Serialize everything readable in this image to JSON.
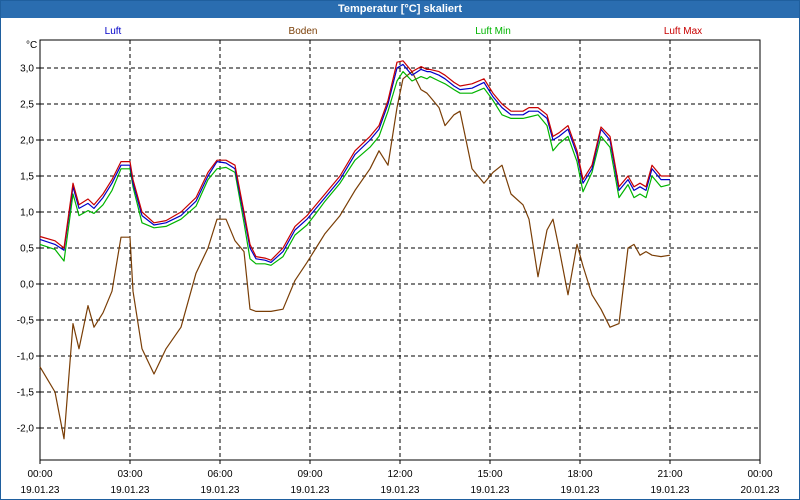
{
  "window": {
    "title": "Temperatur [°C] skaliert"
  },
  "chart_data": {
    "type": "line",
    "title": "Temperatur [°C] skaliert",
    "yunit": "°C",
    "ylim": [
      -2.5,
      3.2
    ],
    "yticks": [
      3.0,
      2.5,
      2.0,
      1.5,
      1.0,
      0.5,
      0.0,
      -0.5,
      -1.0,
      -1.5,
      -2.0
    ],
    "ytick_labels": [
      "3,0",
      "2,5",
      "2,0",
      "1,5",
      "1,0",
      "0,5",
      "0,0",
      "-0,5",
      "-1,0",
      "-1,5",
      "-2,0"
    ],
    "xlim": [
      0,
      24
    ],
    "xticks": [
      {
        "h": 0,
        "time": "00:00",
        "date": "19.01.23"
      },
      {
        "h": 3,
        "time": "03:00",
        "date": "19.01.23"
      },
      {
        "h": 6,
        "time": "06:00",
        "date": "19.01.23"
      },
      {
        "h": 9,
        "time": "09:00",
        "date": "19.01.23"
      },
      {
        "h": 12,
        "time": "12:00",
        "date": "19.01.23"
      },
      {
        "h": 15,
        "time": "15:00",
        "date": "19.01.23"
      },
      {
        "h": 18,
        "time": "18:00",
        "date": "19.01.23"
      },
      {
        "h": 21,
        "time": "21:00",
        "date": "19.01.23"
      },
      {
        "h": 24,
        "time": "00:00",
        "date": "20.01.23"
      }
    ],
    "grid": true,
    "legend_position": "top",
    "x": [
      0,
      0.5,
      0.8,
      1.1,
      1.3,
      1.6,
      1.8,
      2.1,
      2.4,
      2.7,
      3.0,
      3.1,
      3.4,
      3.8,
      4.2,
      4.7,
      5.2,
      5.6,
      5.9,
      6.2,
      6.5,
      6.8,
      7.0,
      7.2,
      7.5,
      7.7,
      8.1,
      8.5,
      8.9,
      9.2,
      9.5,
      10.0,
      10.5,
      11.0,
      11.3,
      11.6,
      11.9,
      12.1,
      12.4,
      12.7,
      12.9,
      13.0,
      13.3,
      13.5,
      13.8,
      14.0,
      14.4,
      14.8,
      15.1,
      15.4,
      15.7,
      16.1,
      16.3,
      16.6,
      16.9,
      17.1,
      17.3,
      17.6,
      17.9,
      18.1,
      18.4,
      18.7,
      19.0,
      19.3,
      19.6,
      19.8,
      20.0,
      20.2,
      20.4,
      20.7,
      21.0,
      21.1,
      21.4,
      21.7,
      22.0,
      22.3,
      22.6,
      23.0,
      23.3,
      23.6,
      24.0
    ],
    "series": [
      {
        "name": "Luft",
        "color": "#0000c8",
        "values": [
          0.62,
          0.55,
          0.47,
          1.35,
          1.05,
          1.12,
          1.05,
          1.2,
          1.4,
          1.65,
          1.65,
          1.4,
          0.95,
          0.82,
          0.85,
          0.95,
          1.15,
          1.5,
          1.7,
          1.68,
          1.6,
          0.95,
          0.5,
          0.35,
          0.33,
          0.3,
          0.45,
          0.75,
          0.9,
          1.05,
          1.2,
          1.45,
          1.8,
          2.0,
          2.15,
          2.5,
          3.0,
          3.05,
          2.9,
          2.98,
          2.95,
          2.95,
          2.9,
          2.85,
          2.75,
          2.7,
          2.72,
          2.8,
          2.6,
          2.45,
          2.35,
          2.35,
          2.4,
          2.4,
          2.3,
          2.0,
          2.05,
          2.15,
          1.8,
          1.4,
          1.6,
          2.15,
          2.0,
          1.3,
          1.45,
          1.3,
          1.35,
          1.3,
          1.6,
          1.45,
          1.45
        ]
      },
      {
        "name": "Boden",
        "color": "#7a3e06",
        "values": [
          -1.15,
          -1.5,
          -2.15,
          -0.55,
          -0.9,
          -0.3,
          -0.6,
          -0.4,
          -0.1,
          0.65,
          0.65,
          -0.1,
          -0.9,
          -1.25,
          -0.9,
          -0.6,
          0.15,
          0.5,
          0.9,
          0.9,
          0.6,
          0.45,
          -0.35,
          -0.38,
          -0.38,
          -0.38,
          -0.35,
          0.05,
          0.3,
          0.5,
          0.7,
          0.95,
          1.3,
          1.6,
          1.85,
          1.65,
          2.45,
          2.85,
          2.95,
          2.7,
          2.65,
          2.6,
          2.45,
          2.2,
          2.35,
          2.4,
          1.6,
          1.4,
          1.55,
          1.65,
          1.25,
          1.1,
          0.9,
          0.1,
          0.75,
          0.9,
          0.5,
          -0.15,
          0.55,
          0.25,
          -0.15,
          -0.35,
          -0.6,
          -0.55,
          0.5,
          0.55,
          0.4,
          0.45,
          0.4,
          0.38,
          0.4
        ]
      },
      {
        "name": "Luft Min",
        "color": "#00b400",
        "values": [
          0.55,
          0.48,
          0.32,
          1.25,
          0.95,
          1.02,
          0.98,
          1.1,
          1.3,
          1.6,
          1.6,
          1.35,
          0.85,
          0.78,
          0.8,
          0.9,
          1.08,
          1.45,
          1.6,
          1.62,
          1.55,
          0.85,
          0.35,
          0.28,
          0.28,
          0.26,
          0.38,
          0.68,
          0.82,
          0.98,
          1.15,
          1.4,
          1.72,
          1.9,
          2.05,
          2.4,
          2.82,
          2.95,
          2.82,
          2.88,
          2.85,
          2.88,
          2.82,
          2.78,
          2.7,
          2.65,
          2.65,
          2.72,
          2.55,
          2.35,
          2.3,
          2.3,
          2.32,
          2.35,
          2.2,
          1.85,
          1.95,
          2.05,
          1.7,
          1.28,
          1.55,
          2.05,
          1.9,
          1.2,
          1.38,
          1.2,
          1.25,
          1.2,
          1.5,
          1.35,
          1.38
        ]
      },
      {
        "name": "Luft Max",
        "color": "#c80000",
        "values": [
          0.66,
          0.6,
          0.5,
          1.4,
          1.1,
          1.18,
          1.1,
          1.25,
          1.45,
          1.7,
          1.7,
          1.45,
          1.0,
          0.85,
          0.88,
          1.0,
          1.2,
          1.55,
          1.72,
          1.72,
          1.65,
          1.0,
          0.55,
          0.38,
          0.36,
          0.33,
          0.5,
          0.8,
          0.95,
          1.1,
          1.25,
          1.5,
          1.85,
          2.05,
          2.2,
          2.55,
          3.08,
          3.1,
          2.95,
          3.02,
          2.98,
          2.98,
          2.95,
          2.9,
          2.8,
          2.75,
          2.78,
          2.85,
          2.65,
          2.5,
          2.4,
          2.4,
          2.45,
          2.45,
          2.35,
          2.05,
          2.1,
          2.2,
          1.85,
          1.45,
          1.65,
          2.18,
          2.05,
          1.35,
          1.5,
          1.35,
          1.4,
          1.35,
          1.65,
          1.5,
          1.5
        ]
      }
    ]
  }
}
